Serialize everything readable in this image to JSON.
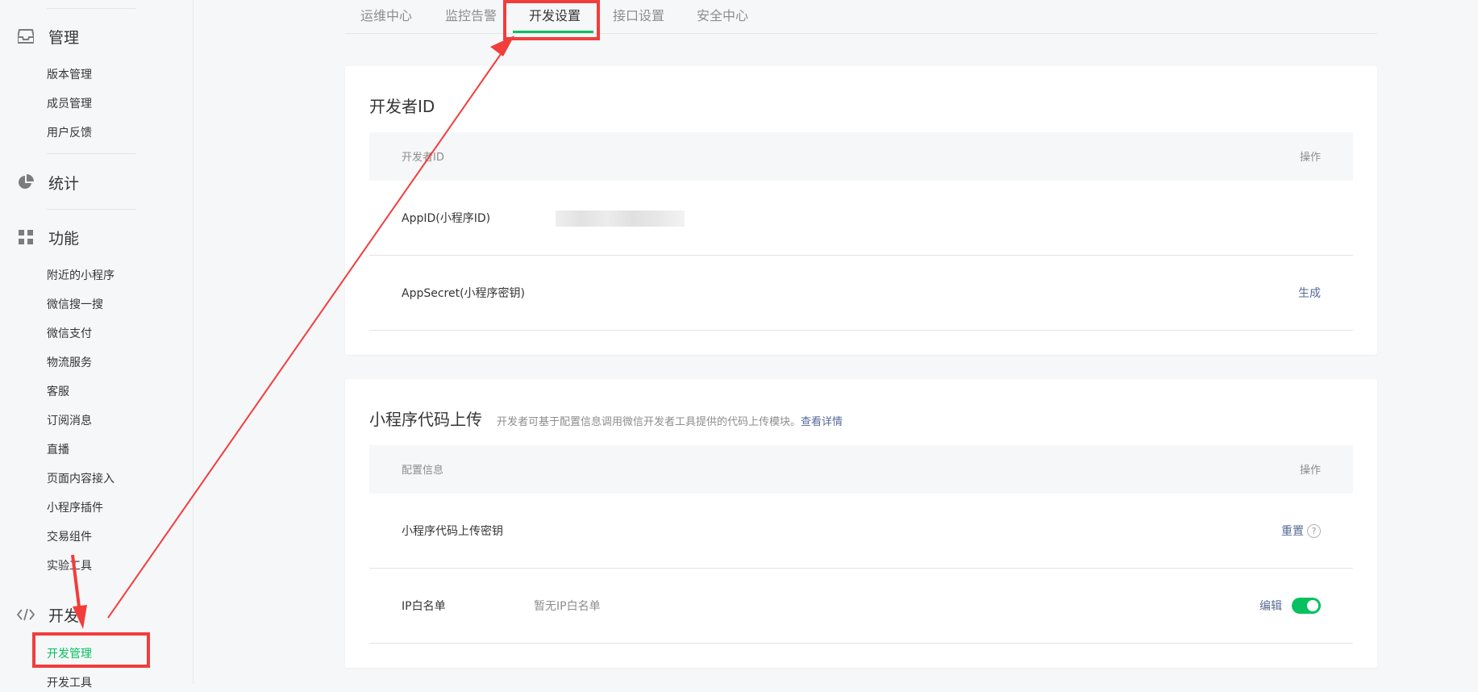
{
  "sidebar": {
    "sections": [
      {
        "key": "manage",
        "title": "管理",
        "icon": "inbox-icon"
      },
      {
        "key": "stats",
        "title": "统计",
        "icon": "pie-chart-icon"
      },
      {
        "key": "features",
        "title": "功能",
        "icon": "grid-icon"
      },
      {
        "key": "dev",
        "title": "开发",
        "icon": "code-icon"
      }
    ],
    "manage_items": [
      "版本管理",
      "成员管理",
      "用户反馈"
    ],
    "feature_items": [
      "附近的小程序",
      "微信搜一搜",
      "微信支付",
      "物流服务",
      "客服",
      "订阅消息",
      "直播",
      "页面内容接入",
      "小程序插件",
      "交易组件",
      "实验工具"
    ],
    "dev_items": [
      "开发管理",
      "开发工具"
    ]
  },
  "tabs": [
    "运维中心",
    "监控告警",
    "开发设置",
    "接口设置",
    "安全中心"
  ],
  "active_tab": "开发设置",
  "developer_id_card": {
    "title": "开发者ID",
    "header_left": "开发者ID",
    "header_right": "操作",
    "rows": [
      {
        "label": "AppID(小程序ID)",
        "value": "",
        "action": ""
      },
      {
        "label": "AppSecret(小程序密钥)",
        "value": "",
        "action": "生成"
      }
    ]
  },
  "upload_card": {
    "title": "小程序代码上传",
    "subtitle": "开发者可基于配置信息调用微信开发者工具提供的代码上传模块。",
    "subtitle_link": "查看详情",
    "header_left": "配置信息",
    "header_right": "操作",
    "rows": [
      {
        "label": "小程序代码上传密钥",
        "value": "",
        "action": "重置",
        "help": "?"
      },
      {
        "label": "IP白名单",
        "value": "暂无IP白名单",
        "action": "编辑",
        "toggle_on": true
      }
    ]
  },
  "colors": {
    "accent_green": "#07c160",
    "link_blue": "#576b95",
    "annotation_red": "#f23d3d"
  }
}
